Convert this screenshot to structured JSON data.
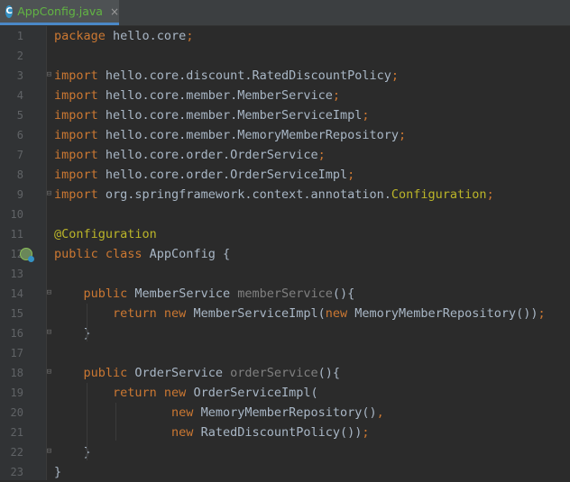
{
  "tab": {
    "icon": "C",
    "filename": "AppConfig.java",
    "close": "×"
  },
  "lines": [
    {
      "n": "1",
      "t": [
        {
          "c": "kw",
          "s": "package "
        },
        {
          "c": "id",
          "s": "hello.core"
        },
        {
          "c": "kw",
          "s": ";"
        }
      ]
    },
    {
      "n": "2",
      "t": []
    },
    {
      "n": "3",
      "t": [
        {
          "c": "kw",
          "s": "import "
        },
        {
          "c": "id",
          "s": "hello.core.discount.RatedDiscountPolicy"
        },
        {
          "c": "kw",
          "s": ";"
        }
      ]
    },
    {
      "n": "4",
      "t": [
        {
          "c": "kw",
          "s": "import "
        },
        {
          "c": "id",
          "s": "hello.core.member.MemberService"
        },
        {
          "c": "kw",
          "s": ";"
        }
      ]
    },
    {
      "n": "5",
      "t": [
        {
          "c": "kw",
          "s": "import "
        },
        {
          "c": "id",
          "s": "hello.core.member.MemberServiceImpl"
        },
        {
          "c": "kw",
          "s": ";"
        }
      ]
    },
    {
      "n": "6",
      "t": [
        {
          "c": "kw",
          "s": "import "
        },
        {
          "c": "id",
          "s": "hello.core.member.MemoryMemberRepository"
        },
        {
          "c": "kw",
          "s": ";"
        }
      ]
    },
    {
      "n": "7",
      "t": [
        {
          "c": "kw",
          "s": "import "
        },
        {
          "c": "id",
          "s": "hello.core.order.OrderService"
        },
        {
          "c": "kw",
          "s": ";"
        }
      ]
    },
    {
      "n": "8",
      "t": [
        {
          "c": "kw",
          "s": "import "
        },
        {
          "c": "id",
          "s": "hello.core.order.OrderServiceImpl"
        },
        {
          "c": "kw",
          "s": ";"
        }
      ]
    },
    {
      "n": "9",
      "t": [
        {
          "c": "kw",
          "s": "import "
        },
        {
          "c": "id",
          "s": "org.springframework.context.annotation."
        },
        {
          "c": "ann",
          "s": "Configuration"
        },
        {
          "c": "kw",
          "s": ";"
        }
      ]
    },
    {
      "n": "10",
      "t": []
    },
    {
      "n": "11",
      "t": [
        {
          "c": "ann",
          "s": "@Configuration"
        }
      ]
    },
    {
      "n": "12",
      "t": [
        {
          "c": "kw",
          "s": "public class "
        },
        {
          "c": "id",
          "s": "AppConfig {"
        }
      ]
    },
    {
      "n": "13",
      "t": []
    },
    {
      "n": "14",
      "t": [
        {
          "c": "id",
          "s": "    "
        },
        {
          "c": "kw",
          "s": "public "
        },
        {
          "c": "id",
          "s": "MemberService "
        },
        {
          "c": "gray",
          "s": "memberService"
        },
        {
          "c": "id",
          "s": "(){"
        }
      ]
    },
    {
      "n": "15",
      "t": [
        {
          "c": "id",
          "s": "        "
        },
        {
          "c": "kw",
          "s": "return new "
        },
        {
          "c": "id",
          "s": "MemberServiceImpl("
        },
        {
          "c": "kw",
          "s": "new "
        },
        {
          "c": "id",
          "s": "MemoryMemberRepository())"
        },
        {
          "c": "kw",
          "s": ";"
        }
      ]
    },
    {
      "n": "16",
      "t": [
        {
          "c": "id",
          "s": "    }"
        }
      ]
    },
    {
      "n": "17",
      "t": []
    },
    {
      "n": "18",
      "t": [
        {
          "c": "id",
          "s": "    "
        },
        {
          "c": "kw",
          "s": "public "
        },
        {
          "c": "id",
          "s": "OrderService "
        },
        {
          "c": "gray",
          "s": "orderService"
        },
        {
          "c": "id",
          "s": "(){"
        }
      ]
    },
    {
      "n": "19",
      "t": [
        {
          "c": "id",
          "s": "        "
        },
        {
          "c": "kw",
          "s": "return new "
        },
        {
          "c": "id",
          "s": "OrderServiceImpl("
        }
      ]
    },
    {
      "n": "20",
      "t": [
        {
          "c": "id",
          "s": "                "
        },
        {
          "c": "kw",
          "s": "new "
        },
        {
          "c": "id",
          "s": "MemoryMemberRepository()"
        },
        {
          "c": "kw",
          "s": ","
        }
      ]
    },
    {
      "n": "21",
      "t": [
        {
          "c": "id",
          "s": "                "
        },
        {
          "c": "kw",
          "s": "new "
        },
        {
          "c": "id",
          "s": "RatedDiscountPolicy())"
        },
        {
          "c": "kw",
          "s": ";"
        }
      ]
    },
    {
      "n": "22",
      "t": [
        {
          "c": "id",
          "s": "    }"
        }
      ]
    },
    {
      "n": "23",
      "t": [
        {
          "c": "id",
          "s": "}"
        }
      ]
    }
  ],
  "fold_markers": [
    "3",
    "9",
    "14",
    "16",
    "18",
    "22"
  ],
  "gutter_icons": [
    {
      "line": "12",
      "name": "spring-bean-icon"
    }
  ],
  "colors": {
    "background": "#2b2b2b",
    "keyword": "#cc7832",
    "identifier": "#a9b7c6",
    "annotation": "#bbb529",
    "unused": "#808080",
    "line_number": "#606366",
    "tab_text": "#62b543"
  }
}
